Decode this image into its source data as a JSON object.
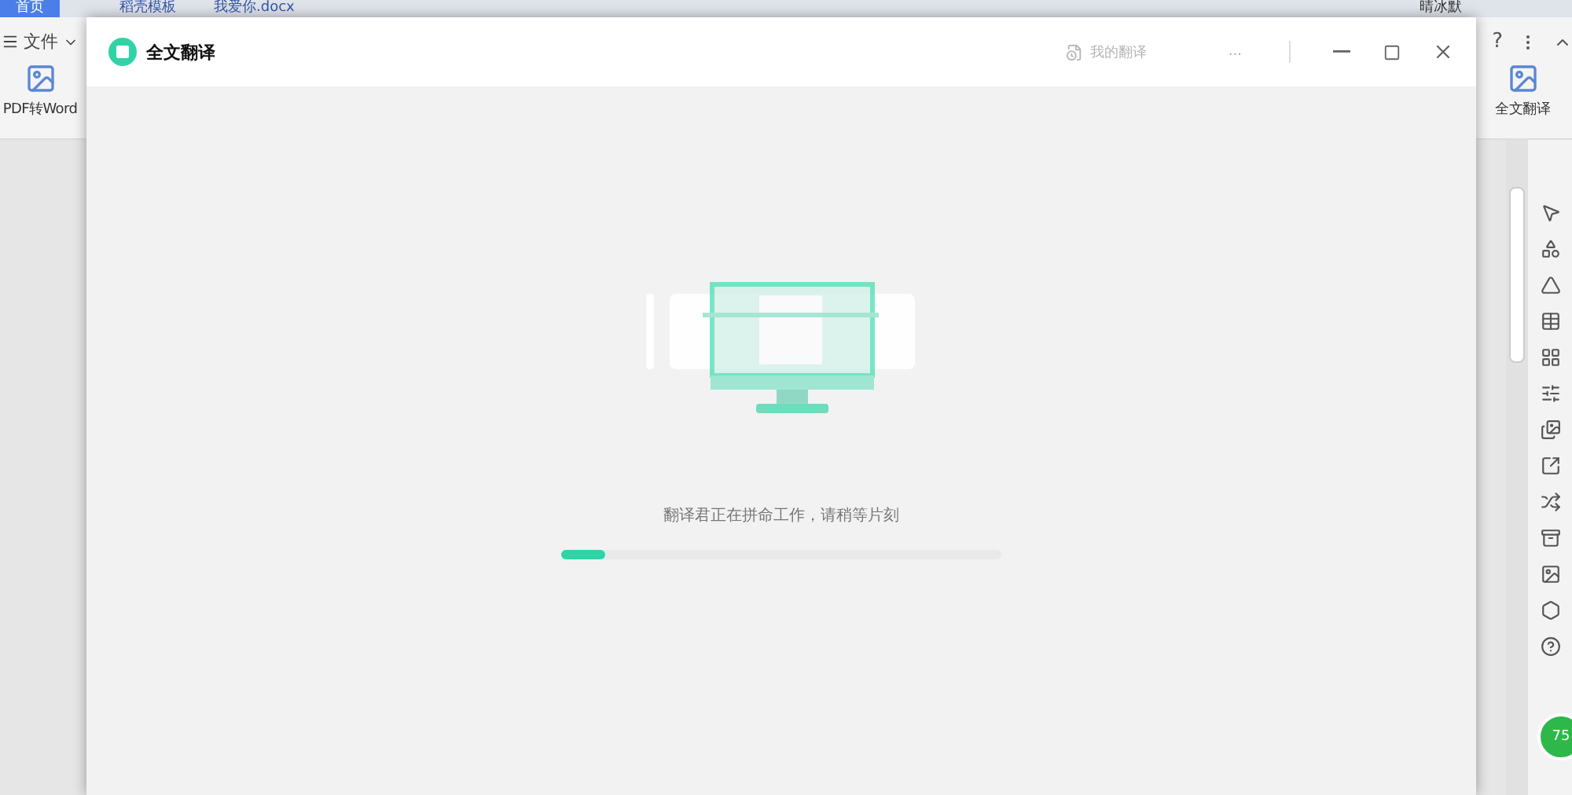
{
  "app_tabs": [
    {
      "label": "首页",
      "selected": true
    },
    {
      "label": "稻壳模板",
      "selected": false
    },
    {
      "label": "我爱你.docx",
      "selected": false
    }
  ],
  "user": {
    "name": "晴冰默"
  },
  "ribbon": {
    "menu": "文件",
    "left_button": "PDF转Word",
    "right_button": "全文翻译",
    "help": "?"
  },
  "badge": "75",
  "dialog": {
    "title": "全文翻译",
    "history_link": "我的翻译",
    "more": "...",
    "status_text": "翻译君正在拼命工作，请稍等片刻",
    "progress": {
      "level": 0.1
    }
  }
}
